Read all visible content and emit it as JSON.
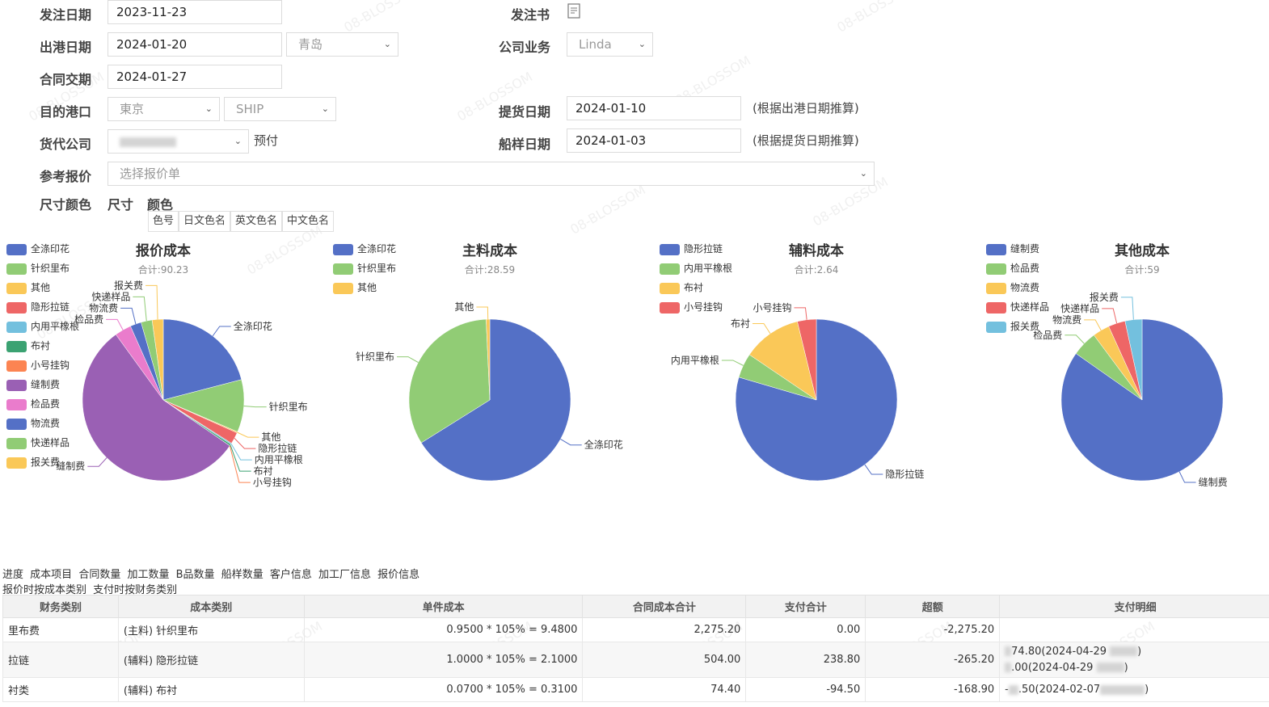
{
  "form": {
    "order_date_label": "发注日期",
    "order_date": "2023-11-23",
    "order_doc_label": "发注书",
    "ship_date_label": "出港日期",
    "ship_date": "2024-01-20",
    "ship_port": "青岛",
    "company_business_label": "公司业务",
    "company_business": "Linda",
    "contract_date_label": "合同交期",
    "contract_date": "2024-01-27",
    "dest_port_label": "目的港口",
    "dest_port": "東京",
    "transport": "SHIP",
    "pickup_date_label": "提货日期",
    "pickup_date": "2024-01-10",
    "pickup_note": "(根据出港日期推算)",
    "forwarder_label": "货代公司",
    "prepay": "预付",
    "sample_date_label": "船样日期",
    "sample_date": "2024-01-03",
    "sample_note": "(根据提货日期推算)",
    "ref_quote_label": "参考报价",
    "ref_quote_placeholder": "选择报价单",
    "size_color_label": "尺寸颜色",
    "size_label": "尺寸",
    "color_label": "颜色",
    "color_cols": [
      "色号",
      "日文色名",
      "英文色名",
      "中文色名"
    ]
  },
  "chart_data": [
    {
      "type": "pie",
      "title": "报价成本",
      "subtitle": "合计:90.23",
      "legend": [
        "全涤印花",
        "针织里布",
        "其他",
        "隐形拉链",
        "内用平橡根",
        "布衬",
        "小号挂钩",
        "缝制费",
        "检品费",
        "物流费",
        "快递样品",
        "报关费"
      ],
      "slices": [
        {
          "name": "全涤印花",
          "value": 18.9,
          "color": "#5470c6"
        },
        {
          "name": "针织里布",
          "value": 9.48,
          "color": "#91cc75"
        },
        {
          "name": "其他",
          "value": 0.21,
          "color": "#fac858"
        },
        {
          "name": "隐形拉链",
          "value": 2.1,
          "color": "#ee6666"
        },
        {
          "name": "内用平橡根",
          "value": 0.21,
          "color": "#73c0de"
        },
        {
          "name": "布衬",
          "value": 0.31,
          "color": "#3ba272"
        },
        {
          "name": "小号挂钩",
          "value": 0.02,
          "color": "#fc8452"
        },
        {
          "name": "缝制费",
          "value": 50.0,
          "color": "#9a60b4"
        },
        {
          "name": "检品费",
          "value": 3.0,
          "color": "#ea7ccc"
        },
        {
          "name": "物流费",
          "value": 2.0,
          "color": "#5470c6"
        },
        {
          "name": "快递样品",
          "value": 2.0,
          "color": "#91cc75"
        },
        {
          "name": "报关费",
          "value": 2.0,
          "color": "#fac858"
        }
      ]
    },
    {
      "type": "pie",
      "title": "主料成本",
      "subtitle": "合计:28.59",
      "legend": [
        "全涤印花",
        "针织里布",
        "其他"
      ],
      "slices": [
        {
          "name": "全涤印花",
          "value": 18.9,
          "color": "#5470c6"
        },
        {
          "name": "针织里布",
          "value": 9.48,
          "color": "#91cc75"
        },
        {
          "name": "其他",
          "value": 0.21,
          "color": "#fac858"
        }
      ]
    },
    {
      "type": "pie",
      "title": "辅料成本",
      "subtitle": "合计:2.64",
      "legend": [
        "隐形拉链",
        "内用平橡根",
        "布衬",
        "小号挂钩"
      ],
      "slices": [
        {
          "name": "隐形拉链",
          "value": 2.1,
          "color": "#5470c6"
        },
        {
          "name": "内用平橡根",
          "value": 0.13,
          "color": "#91cc75"
        },
        {
          "name": "布衬",
          "value": 0.31,
          "color": "#fac858"
        },
        {
          "name": "小号挂钩",
          "value": 0.1,
          "color": "#ee6666"
        }
      ]
    },
    {
      "type": "pie",
      "title": "其他成本",
      "subtitle": "合计:59",
      "legend": [
        "缝制费",
        "检品费",
        "物流费",
        "快递样品",
        "报关费"
      ],
      "slices": [
        {
          "name": "缝制费",
          "value": 50,
          "color": "#5470c6"
        },
        {
          "name": "检品费",
          "value": 3,
          "color": "#91cc75"
        },
        {
          "name": "物流费",
          "value": 2,
          "color": "#fac858"
        },
        {
          "name": "快递样品",
          "value": 2,
          "color": "#ee6666"
        },
        {
          "name": "报关费",
          "value": 2,
          "color": "#73c0de"
        }
      ]
    }
  ],
  "links": {
    "row1": [
      "进度",
      "成本项目",
      "合同数量",
      "加工数量",
      "B品数量",
      "船样数量",
      "客户信息",
      "加工厂信息",
      "报价信息"
    ],
    "row2": [
      "报价时按成本类别",
      "支付时按财务类别"
    ]
  },
  "table": {
    "headers": [
      "财务类别",
      "成本类别",
      "单件成本",
      "合同成本合计",
      "支付合计",
      "超额",
      "支付明细"
    ],
    "rows": [
      {
        "cat": "里布费",
        "cost_cat": "(主料) 针织里布",
        "unit": "0.9500 * 105% = 9.4800",
        "contract": "2,275.20",
        "paid": "0.00",
        "over": "-2,275.20",
        "detail1": "",
        "detail2": ""
      },
      {
        "cat": "拉链",
        "cost_cat": "(辅料) 隐形拉链",
        "unit": "1.0000 * 105% = 2.1000",
        "contract": "504.00",
        "paid": "238.80",
        "over": "-265.20",
        "detail1": "74.80(2024-04-29",
        "detail2": ".00(2024-04-29"
      },
      {
        "cat": "衬类",
        "cost_cat": "(辅料) 布衬",
        "unit": "0.0700 * 105% = 0.3100",
        "contract": "74.40",
        "paid": "-94.50",
        "over": "-168.90",
        "detail1": ".50(2024-02-07",
        "detail2": ""
      }
    ]
  },
  "watermark": "08-BLOSSOM"
}
